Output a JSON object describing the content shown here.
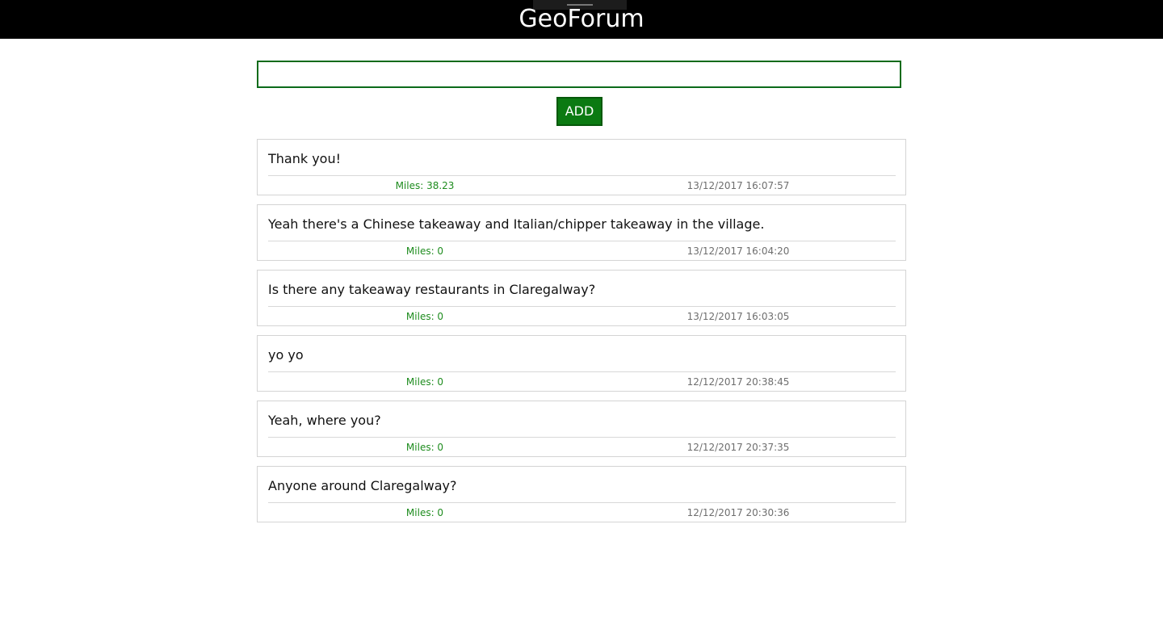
{
  "header": {
    "title": "GeoForum"
  },
  "composer": {
    "input_value": "",
    "add_label": "ADD"
  },
  "posts": [
    {
      "text": "Thank you!",
      "miles": "Miles: 38.23",
      "timestamp": "13/12/2017 16:07:57"
    },
    {
      "text": "Yeah there's a Chinese takeaway and Italian/chipper takeaway in the village.",
      "miles": "Miles: 0",
      "timestamp": "13/12/2017 16:04:20"
    },
    {
      "text": "Is there any takeaway restaurants in Claregalway?",
      "miles": "Miles: 0",
      "timestamp": "13/12/2017 16:03:05"
    },
    {
      "text": "yo yo",
      "miles": "Miles: 0",
      "timestamp": "12/12/2017 20:38:45"
    },
    {
      "text": "Yeah, where you?",
      "miles": "Miles: 0",
      "timestamp": "12/12/2017 20:37:35"
    },
    {
      "text": "Anyone around Claregalway?",
      "miles": "Miles: 0",
      "timestamp": "12/12/2017 20:30:36"
    }
  ],
  "colors": {
    "header_background": "#000000",
    "accent_green": "#0b7a12",
    "miles_green": "#1e8c1e",
    "timestamp_gray": "#6e6e6e"
  }
}
